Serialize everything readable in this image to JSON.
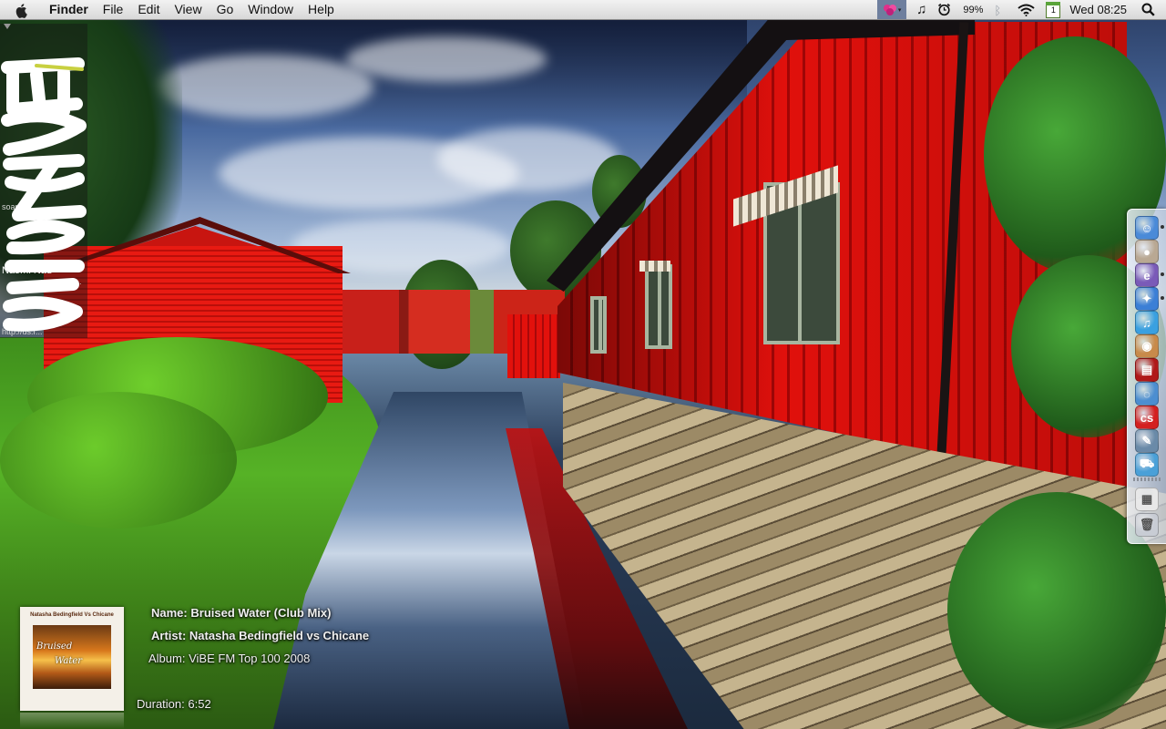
{
  "menubar": {
    "apple_icon": "apple-icon",
    "app_name": "Finder",
    "menus": [
      "File",
      "Edit",
      "View",
      "Go",
      "Window",
      "Help"
    ],
    "status": {
      "app_icon": "flower-app-icon",
      "music_icon": "music-note-icon",
      "alarm_icon": "alarm-clock-icon",
      "battery": "99%",
      "bluetooth_icon": "bluetooth-icon",
      "wifi_icon": "wifi-icon",
      "calendar_day": "1",
      "clock": "Wed 08:25",
      "spotlight_icon": "magnifier-icon"
    }
  },
  "twitter_widget": {
    "lines": [
      "soare",
      "Naomi Nad",
      "world!...",
      "verd...",
      "http://us.r..."
    ]
  },
  "now_playing": {
    "name_label": "Name:",
    "name": "Bruised Water (Club Mix)",
    "artist_label": "Artist:",
    "artist": "Natasha Bedingfield vs Chicane",
    "album_label": "Album:",
    "album": "ViBE FM Top 100 2008",
    "duration_label": "Duration:",
    "duration": "6:52",
    "cover": {
      "header": "Natasha Bedingfield Vs Chicane",
      "line1": "Bruised",
      "line2": "Water"
    }
  },
  "dock": {
    "items": [
      {
        "name": "finder-icon",
        "color": "#4a8ad8",
        "glyph": "☺",
        "running": true
      },
      {
        "name": "mouse-icon",
        "color": "#b9a893",
        "glyph": "●",
        "running": false
      },
      {
        "name": "msn-messenger-icon",
        "color": "#7a5ab8",
        "glyph": "e",
        "running": true
      },
      {
        "name": "safari-icon",
        "color": "#3b7fd6",
        "glyph": "✦",
        "running": true
      },
      {
        "name": "itunes-icon",
        "color": "#3aa0e0",
        "glyph": "♫",
        "running": false
      },
      {
        "name": "coffee-icon",
        "color": "#c88a4a",
        "glyph": "◉",
        "running": false
      },
      {
        "name": "photo-booth-icon",
        "color": "#b01818",
        "glyph": "▤",
        "running": false
      },
      {
        "name": "network-utility-icon",
        "color": "#4c8ed0",
        "glyph": "◌",
        "running": false
      },
      {
        "name": "adobe-cs-icon",
        "color": "#d42020",
        "glyph": "cs",
        "running": false
      },
      {
        "name": "system-tools-icon",
        "color": "#6a8aa8",
        "glyph": "✎",
        "running": false
      },
      {
        "name": "transmit-icon",
        "color": "#4aa0d8",
        "glyph": "⛟",
        "running": false
      },
      {
        "name": "document-icon",
        "color": "#e8e8e8",
        "glyph": "▦",
        "running": false
      },
      {
        "name": "trash-icon",
        "color": "#c8ccd4",
        "glyph": "🗑",
        "running": false
      }
    ]
  }
}
